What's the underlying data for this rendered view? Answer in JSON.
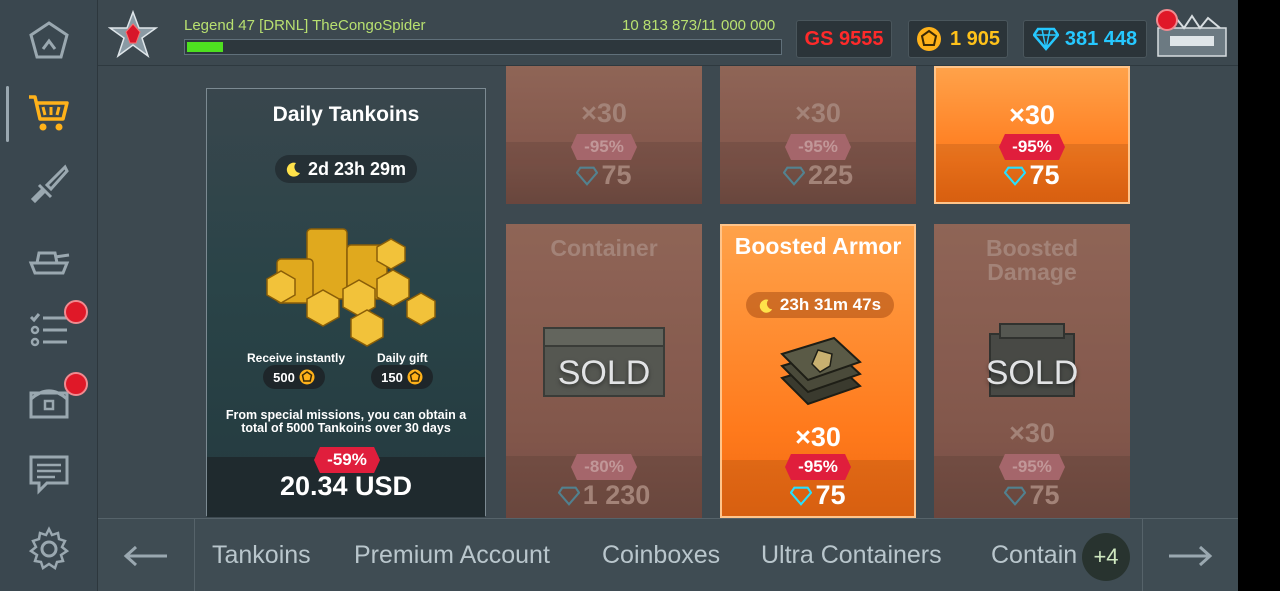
{
  "player": {
    "name": "Legend 47  [DRNL] TheCongoSpider",
    "xp": "10 813 873/11 000 000",
    "xp_progress": 0.06
  },
  "currencies": {
    "gs": "GS 9555",
    "tankoins": "1 905",
    "gems": "381 448"
  },
  "sidebar": [
    {
      "icon": "home-icon"
    },
    {
      "icon": "cart-icon",
      "active": true
    },
    {
      "icon": "sword-icon"
    },
    {
      "icon": "tank-icon"
    },
    {
      "icon": "missions-list-icon",
      "notification": true
    },
    {
      "icon": "chest-icon",
      "notification": true
    },
    {
      "icon": "chat-icon"
    },
    {
      "icon": "gear-icon"
    }
  ],
  "daily": {
    "title": "Daily Tankoins",
    "timer": "2d 23h 29m",
    "receive_label": "Receive instantly",
    "receive_value": "500",
    "gift_label": "Daily gift",
    "gift_value": "150",
    "description": "From special missions, you can obtain a total of 5000 Tankoins over 30 days",
    "discount": "-59%",
    "price": "20.34 USD"
  },
  "cards_top": [
    {
      "qty": "×30",
      "discount": "-95%",
      "price": "75"
    },
    {
      "qty": "×30",
      "discount": "-95%",
      "price": "225"
    },
    {
      "qty": "×30",
      "discount": "-95%",
      "price": "75"
    }
  ],
  "cards_bottom": [
    {
      "title": "Container",
      "sold": "SOLD",
      "discount": "-80%",
      "price": "1 230"
    },
    {
      "title": "Boosted Armor",
      "timer": "23h 31m 47s",
      "qty": "×30",
      "discount": "-95%",
      "price": "75"
    },
    {
      "title": "Boosted Damage",
      "sold": "SOLD",
      "qty": "×30",
      "discount": "-95%",
      "price": "75"
    }
  ],
  "tabs": [
    "Tankoins",
    "Premium Account",
    "Coinboxes",
    "Ultra Containers",
    "Contain"
  ],
  "more_tabs": "+4"
}
